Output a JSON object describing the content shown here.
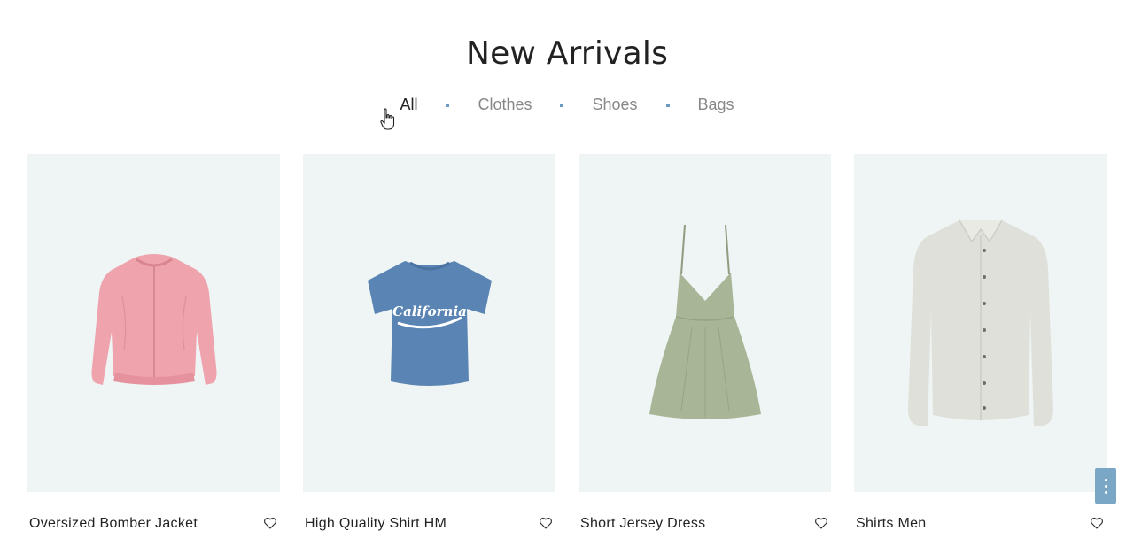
{
  "heading": "New Arrivals",
  "filters": [
    {
      "label": "All",
      "active": true
    },
    {
      "label": "Clothes",
      "active": false
    },
    {
      "label": "Shoes",
      "active": false
    },
    {
      "label": "Bags",
      "active": false
    }
  ],
  "products": [
    {
      "name": "Oversized Bomber Jacket",
      "image": "pink-bomber-jacket"
    },
    {
      "name": "High Quality Shirt HM",
      "image": "blue-california-tshirt"
    },
    {
      "name": "Short Jersey Dress",
      "image": "green-strap-dress"
    },
    {
      "name": "Shirts Men",
      "image": "grey-button-shirt"
    }
  ],
  "tshirt_print": "California",
  "colors": {
    "accent": "#6c9ac0",
    "tile_bg": "#eef5f4",
    "jacket": "#eea3ad",
    "tshirt": "#5a84b3",
    "dress": "#a8b597",
    "shirt": "#dfe0da"
  }
}
